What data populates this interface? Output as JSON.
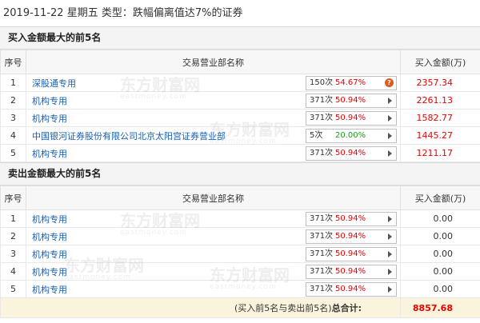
{
  "header": {
    "date": "2019-11-22",
    "weekday": "星期五",
    "type_label": "类型：跌幅偏离值达7%的证券"
  },
  "columns": {
    "index": "序号",
    "dept": "交易营业部名称",
    "amount": "买入金额(万)"
  },
  "buy": {
    "title": "买入金额最大的前5名",
    "rows": [
      {
        "idx": "1",
        "name": "深股通专用",
        "count": "150次",
        "pct": "54.67%",
        "pct_color": "red",
        "icon": "question-icon",
        "amount": "2357.34"
      },
      {
        "idx": "2",
        "name": "机构专用",
        "count": "371次",
        "pct": "50.94%",
        "pct_color": "red",
        "icon": "play-arrow-icon",
        "amount": "2261.13"
      },
      {
        "idx": "3",
        "name": "机构专用",
        "count": "371次",
        "pct": "50.94%",
        "pct_color": "red",
        "icon": "play-arrow-icon",
        "amount": "1582.77"
      },
      {
        "idx": "4",
        "name": "中国银河证券股份有限公司北京太阳宫证券营业部",
        "count": "5次",
        "pct": "20.00%",
        "pct_color": "green",
        "icon": "play-arrow-icon",
        "amount": "1445.27"
      },
      {
        "idx": "5",
        "name": "机构专用",
        "count": "371次",
        "pct": "50.94%",
        "pct_color": "red",
        "icon": "play-arrow-icon",
        "amount": "1211.17"
      }
    ]
  },
  "sell": {
    "title": "卖出金额最大的前5名",
    "rows": [
      {
        "idx": "1",
        "name": "机构专用",
        "count": "371次",
        "pct": "50.94%",
        "pct_color": "red",
        "icon": "play-arrow-icon",
        "amount": "0.00"
      },
      {
        "idx": "2",
        "name": "机构专用",
        "count": "371次",
        "pct": "50.94%",
        "pct_color": "red",
        "icon": "play-arrow-icon",
        "amount": "0.00"
      },
      {
        "idx": "3",
        "name": "机构专用",
        "count": "371次",
        "pct": "50.94%",
        "pct_color": "red",
        "icon": "play-arrow-icon",
        "amount": "0.00"
      },
      {
        "idx": "4",
        "name": "机构专用",
        "count": "371次",
        "pct": "50.94%",
        "pct_color": "red",
        "icon": "play-arrow-icon",
        "amount": "0.00"
      },
      {
        "idx": "5",
        "name": "机构专用",
        "count": "371次",
        "pct": "50.94%",
        "pct_color": "red",
        "icon": "play-arrow-icon",
        "amount": "0.00"
      }
    ]
  },
  "total": {
    "prefix": "(买入前5名与卖出前5名)",
    "label": "总合计:",
    "value": "8857.68"
  },
  "watermark": {
    "cn": "东方财富网",
    "en": "eastmoney.com"
  },
  "colors": {
    "red": "#e00000",
    "green": "#1a9a1a",
    "link": "#1a5fb4",
    "total_bg": "#fbf4dc"
  }
}
